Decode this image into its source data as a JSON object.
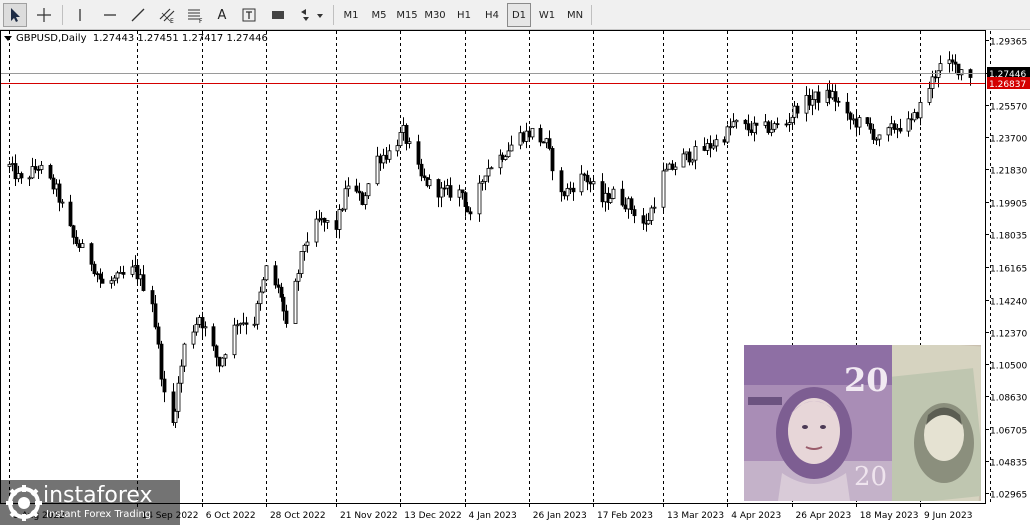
{
  "toolbar": {
    "timeframes": [
      "M1",
      "M5",
      "M15",
      "M30",
      "H1",
      "H4",
      "D1",
      "W1",
      "MN"
    ],
    "active_timeframe": "D1",
    "tool_icons": [
      "cursor-arrow-icon",
      "crosshair-icon",
      "vertical-line-icon",
      "horizontal-line-icon",
      "trendline-icon",
      "equidistant-channel-icon",
      "fibonacci-icon",
      "text-icon",
      "text-label-icon",
      "rectangle-icon",
      "shapes-dropdown-icon"
    ],
    "text_tool_label": "A"
  },
  "chart_header": {
    "symbol": "GBPUSD,Daily",
    "ohlc": "1.27443 1.27451 1.27417 1.27446"
  },
  "price_labels": {
    "current": "1.27446",
    "current_color": "#000000",
    "marker": "1.26837",
    "marker_color": "#d40000"
  },
  "watermark": {
    "brand": "instaforex",
    "tagline": "Instant Forex Trading"
  },
  "chart_data": {
    "type": "candlestick",
    "symbol": "GBPUSD",
    "timeframe": "Daily",
    "y_ticks": [
      "1.29365",
      "1.27446",
      "1.25570",
      "1.23700",
      "1.21830",
      "1.19905",
      "1.18035",
      "1.16165",
      "1.14240",
      "1.12370",
      "1.10500",
      "1.08630",
      "1.06705",
      "1.04835",
      "1.02965"
    ],
    "ylim": [
      1.0297,
      1.2937
    ],
    "x_labels": [
      "1 Aug 2022",
      "14 Sep 2022",
      "6 Oct 2022",
      "28 Oct 2022",
      "21 Nov 2022",
      "13 Dec 2022",
      "4 Jan 2023",
      "26 Jan 2023",
      "17 Feb 2023",
      "13 Mar 2023",
      "4 Apr 2023",
      "26 Apr 2023",
      "18 May 2023",
      "9 Jun 2023"
    ],
    "x_label_dates": [
      "2022-08-01",
      "2022-09-14",
      "2022-10-06",
      "2022-10-28",
      "2022-11-21",
      "2022-12-13",
      "2023-01-04",
      "2023-01-26",
      "2023-02-17",
      "2023-03-13",
      "2023-04-04",
      "2023-04-26",
      "2023-05-18",
      "2023-06-09"
    ],
    "horizontal_lines": [
      {
        "price": 1.26837,
        "color": "#d40000"
      },
      {
        "price": 1.27446,
        "color": "#9a9a9a"
      }
    ],
    "bull_color": "#000000",
    "bear_color": "#000000",
    "bull_body": "#ffffff",
    "bear_body": "#000000",
    "anchors": [
      [
        "2022-08-01",
        1.22
      ],
      [
        "2022-08-05",
        1.211
      ],
      [
        "2022-08-11",
        1.22
      ],
      [
        "2022-08-17",
        1.206
      ],
      [
        "2022-08-23",
        1.178
      ],
      [
        "2022-08-29",
        1.165
      ],
      [
        "2022-09-02",
        1.151
      ],
      [
        "2022-09-08",
        1.155
      ],
      [
        "2022-09-13",
        1.16
      ],
      [
        "2022-09-19",
        1.142
      ],
      [
        "2022-09-23",
        1.086
      ],
      [
        "2022-09-26",
        1.07
      ],
      [
        "2022-09-30",
        1.115
      ],
      [
        "2022-10-05",
        1.133
      ],
      [
        "2022-10-12",
        1.105
      ],
      [
        "2022-10-18",
        1.13
      ],
      [
        "2022-10-24",
        1.13
      ],
      [
        "2022-10-28",
        1.16
      ],
      [
        "2022-11-02",
        1.145
      ],
      [
        "2022-11-04",
        1.125
      ],
      [
        "2022-11-10",
        1.175
      ],
      [
        "2022-11-15",
        1.188
      ],
      [
        "2022-11-21",
        1.185
      ],
      [
        "2022-11-25",
        1.21
      ],
      [
        "2022-11-30",
        1.2
      ],
      [
        "2022-12-05",
        1.225
      ],
      [
        "2022-12-09",
        1.228
      ],
      [
        "2022-12-14",
        1.24
      ],
      [
        "2022-12-20",
        1.213
      ],
      [
        "2022-12-27",
        1.205
      ],
      [
        "2023-01-03",
        1.205
      ],
      [
        "2023-01-06",
        1.189
      ],
      [
        "2023-01-11",
        1.218
      ],
      [
        "2023-01-18",
        1.229
      ],
      [
        "2023-01-23",
        1.238
      ],
      [
        "2023-01-27",
        1.24
      ],
      [
        "2023-02-01",
        1.233
      ],
      [
        "2023-02-06",
        1.203
      ],
      [
        "2023-02-14",
        1.215
      ],
      [
        "2023-02-20",
        1.2
      ],
      [
        "2023-02-24",
        1.204
      ],
      [
        "2023-03-01",
        1.198
      ],
      [
        "2023-03-07",
        1.185
      ],
      [
        "2023-03-13",
        1.215
      ],
      [
        "2023-03-20",
        1.225
      ],
      [
        "2023-03-27",
        1.23
      ],
      [
        "2023-04-03",
        1.238
      ],
      [
        "2023-04-06",
        1.245
      ],
      [
        "2023-04-11",
        1.242
      ],
      [
        "2023-04-17",
        1.242
      ],
      [
        "2023-04-24",
        1.245
      ],
      [
        "2023-04-28",
        1.255
      ],
      [
        "2023-05-04",
        1.26
      ],
      [
        "2023-05-10",
        1.262
      ],
      [
        "2023-05-15",
        1.248
      ],
      [
        "2023-05-22",
        1.243
      ],
      [
        "2023-05-26",
        1.235
      ],
      [
        "2023-05-31",
        1.243
      ],
      [
        "2023-06-06",
        1.245
      ],
      [
        "2023-06-09",
        1.255
      ],
      [
        "2023-06-15",
        1.278
      ],
      [
        "2023-06-20",
        1.279
      ],
      [
        "2023-06-26",
        1.274
      ]
    ]
  }
}
